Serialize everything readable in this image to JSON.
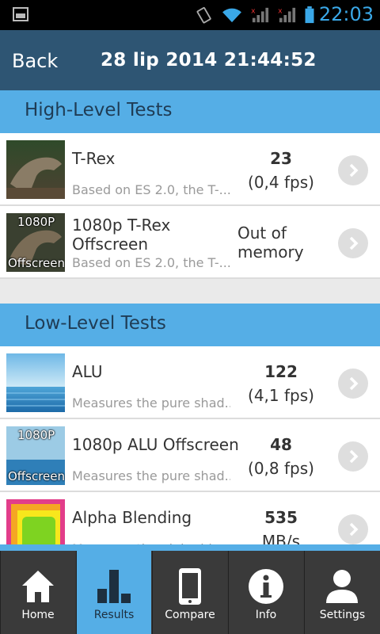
{
  "status": {
    "time": "22:03"
  },
  "header": {
    "back_label": "Back",
    "title": "28 lip 2014 21:44:52"
  },
  "sections": [
    {
      "title": "High-Level Tests",
      "items": [
        {
          "title": "T-Rex",
          "desc": "Based on ES 2.0, the T-...",
          "score": "23",
          "sub": "(0,4 fps)"
        },
        {
          "title_line1": "1080p T-Rex",
          "title_line2": "Offscreen",
          "desc": "Based on ES 2.0, the T-...",
          "score_line1": "Out of",
          "score_line2": "memory",
          "thumb_tag_top": "1080P",
          "thumb_tag_bottom": "Offscreen"
        }
      ]
    },
    {
      "title": "Low-Level Tests",
      "items": [
        {
          "title": "ALU",
          "desc": "Measures the pure shad...",
          "score": "122",
          "sub": "(4,1 fps)"
        },
        {
          "title": "1080p ALU Offscreen",
          "desc": "Measures the pure shad...",
          "score": "48",
          "sub": "(0,8 fps)",
          "thumb_tag_top": "1080P",
          "thumb_tag_bottom": "Offscreen"
        },
        {
          "title": "Alpha Blending",
          "desc": "Measures the alpha bl...",
          "score": "535",
          "sub": "MB/s"
        }
      ]
    }
  ],
  "nav": [
    {
      "label": "Home",
      "icon": "home-icon"
    },
    {
      "label": "Results",
      "icon": "bar-chart-icon",
      "active": true
    },
    {
      "label": "Compare",
      "icon": "phone-icon"
    },
    {
      "label": "Info",
      "icon": "info-icon"
    },
    {
      "label": "Settings",
      "icon": "user-icon"
    }
  ],
  "colors": {
    "header": "#2e5573",
    "accent": "#55aee6",
    "statusbar_text": "#3aa8e8",
    "nav_bg": "#383838"
  }
}
